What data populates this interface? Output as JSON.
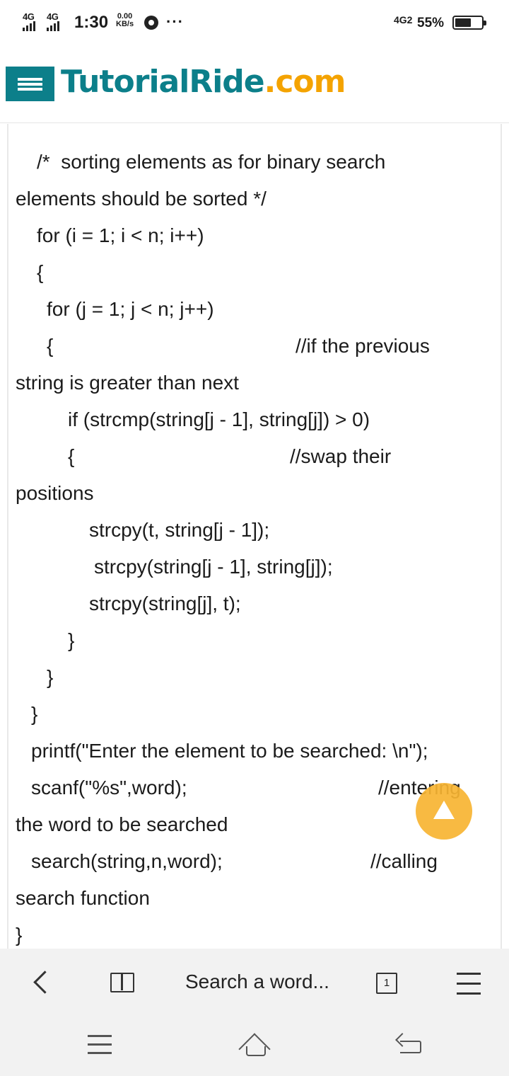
{
  "status_bar": {
    "network_1": "4G",
    "network_2": "4G",
    "time": "1:30",
    "speed_value": "0.00",
    "speed_unit": "KB/s",
    "more_indicator": "···",
    "network_3": "4G2",
    "battery_percent": "55%",
    "battery_level": 0.55
  },
  "header": {
    "brand_name": "TutorialRide",
    "brand_tld": ".com",
    "brand_color": "#0c7f8a",
    "tld_color": "#f4a300"
  },
  "code_lines": [
    "/*  sorting elements as for binary search",
    "elements should be sorted */",
    "for (i = 1; i < n; i++)",
    "{",
    "for (j = 1; j < n; j++)",
    "{",
    "//if the previous",
    "string is greater than next",
    "if (strcmp(string[j - 1], string[j]) > 0)",
    "{",
    "//swap their",
    "positions",
    "strcpy(t, string[j - 1]);",
    "strcpy(string[j - 1], string[j]);",
    "strcpy(string[j], t);",
    "}",
    "}",
    "}",
    "printf(\"Enter the element to be searched: \\n\");",
    "scanf(\"%s\",word);",
    "//entering",
    "the word to be searched",
    "search(string,n,word);",
    "//calling",
    "search function",
    "}"
  ],
  "toolbar": {
    "search_placeholder": "Search a word...",
    "tab_count": "1"
  },
  "icons": {
    "scroll_top": "arrow-up-icon",
    "back": "chevron-left-icon",
    "reader": "book-icon",
    "tabs": "tabs-icon",
    "menu": "hamburger-icon",
    "sys_menu": "recent-apps-icon",
    "sys_home": "home-icon",
    "sys_back": "back-icon"
  },
  "accent_colors": {
    "scroll_top": "#f7b432"
  }
}
